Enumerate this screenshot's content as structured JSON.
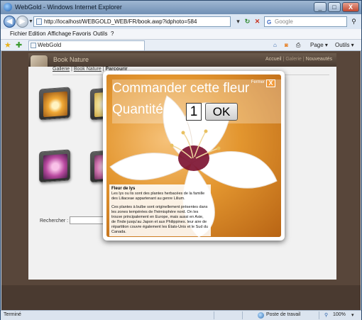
{
  "window": {
    "title": "WebGold - Windows Internet Explorer",
    "controls": {
      "minimize": "_",
      "maximize": "□",
      "close": "X"
    }
  },
  "address": {
    "back_icon": "back-arrow-icon",
    "url": "http://localhost/WEBGOLD_WEB/FR/book.awp?idphoto=584",
    "search_placeholder": "Google",
    "search_brand": "G"
  },
  "menu": [
    "Fichier",
    "Edition",
    "Affichage",
    "Favoris",
    "Outils",
    "?"
  ],
  "tabs": {
    "active_tab": "WebGold",
    "toolbar": {
      "page": "Page",
      "tools": "Outils"
    }
  },
  "site": {
    "name": "Book Nature",
    "nav": {
      "home": "Accueil",
      "gallery": "Galerie",
      "news": "Nouveautés"
    },
    "breadcrumb": {
      "gallery": "Gallerie",
      "book": "Book Nature",
      "current": "Parcourir"
    },
    "search_label": "Rechercher :"
  },
  "modal": {
    "title": "Commander cette fleur",
    "quantity_label": "Quantité :",
    "quantity_value": "1",
    "ok_label": "OK",
    "close_label": "Fermer",
    "close_icon": "X",
    "description": {
      "title": "Fleur de lys",
      "p1": "Les lys ou lis sont des plantes herbacées de la famille des Liliaceae appartenant au genre Lilium.",
      "p2": "Ces plantes à bulbe sont originellement présentes dans les zones tempérées de l'hémisphère nord. On les trouve principalement en Europe, mais aussi en Asie, de l'Inde jusqu'au Japon et aux Philippines. leur aire de répartition couvre également les États-Unis et le Sud du Canada."
    }
  },
  "status": {
    "left": "Terminé",
    "zone": "Poste de travail",
    "zoom": "100%"
  },
  "colors": {
    "accent_orange": "#f29b3a",
    "site_brown": "#58463a",
    "ie_blue": "#3a72b8"
  }
}
